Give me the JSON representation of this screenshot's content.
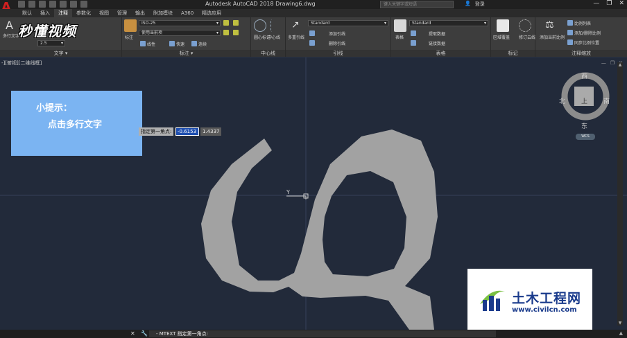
{
  "window": {
    "title": "Autodesk AutoCAD 2018    Drawing6.dwg",
    "search_placeholder": "键入关键字或短语",
    "login_label": "登录",
    "controls": [
      "—",
      "❐",
      "✕"
    ]
  },
  "watermark": "秒懂视频",
  "ribbon_tabs": [
    {
      "label": "默认",
      "active": false
    },
    {
      "label": "插入",
      "active": false
    },
    {
      "label": "注释",
      "active": true
    },
    {
      "label": "参数化",
      "active": false
    },
    {
      "label": "视图",
      "active": false
    },
    {
      "label": "管理",
      "active": false
    },
    {
      "label": "输出",
      "active": false
    },
    {
      "label": "附加模块",
      "active": false
    },
    {
      "label": "A360",
      "active": false
    },
    {
      "label": "精选应用",
      "active": false
    }
  ],
  "panels": {
    "text": {
      "title": "文字 ▾",
      "big_button": "多行文字",
      "size": "2.5"
    },
    "dimension": {
      "title": "标注 ▾",
      "big_button": "标注",
      "style": "ISO-25",
      "layer": "使用当前项",
      "linear": "线性",
      "quick": "快速",
      "continue": "连续"
    },
    "centerline": {
      "title": "中心线",
      "center_mark": "圆心标记",
      "centerline": "中心线"
    },
    "leader": {
      "title": "引线",
      "multileader": "多重引线",
      "style": "Standard",
      "add": "添加引线",
      "remove": "删除引线"
    },
    "table": {
      "title": "表格",
      "table_btn": "表格",
      "style": "Standard",
      "extract": "提取数据",
      "link": "链接数据"
    },
    "markup": {
      "title": "标记",
      "wipeout": "区域覆盖",
      "revcloud": "修订云线"
    },
    "annotation_scale": {
      "title": "注释缩放",
      "add_current": "添加当前比例",
      "scale_list": "比例列表",
      "add_delete": "添加/删除比例",
      "sync": "同步比例位置"
    }
  },
  "viewport": {
    "label": "-][俯视][二维线框]",
    "ucs_label": "Y",
    "viewcube": {
      "top": "北",
      "north": "西",
      "east": "南",
      "south": "东",
      "face": "上",
      "wcs": "WCS"
    }
  },
  "tip": {
    "title": "小提示：",
    "body": "点击多行文字"
  },
  "dynamic_input": {
    "prompt": "指定第一角点:",
    "x_value": "-0.6153",
    "y_value": "1.4337"
  },
  "logo": {
    "name": "土木工程网",
    "url": "www.civilcn.com"
  },
  "command_line": {
    "text": "- MTEXT 指定第一角点:"
  },
  "colors": {
    "shape": "#a2a2a2",
    "viewport_bg": "#222a3a",
    "tip_bg": "#7bb4f2",
    "logo_blue": "#1a3b8c"
  }
}
